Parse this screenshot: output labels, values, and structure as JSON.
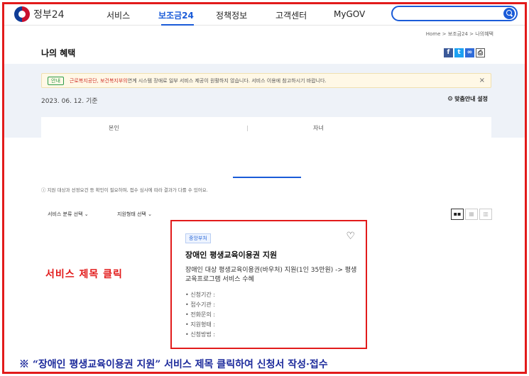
{
  "header": {
    "logo_text": "정부24",
    "nav": [
      "서비스",
      "보조금24",
      "정책정보",
      "고객센터",
      "MyGOV"
    ],
    "active_nav": "보조금24",
    "search_placeholder": ""
  },
  "breadcrumb": "Home  >  보조금24  >  나의혜택",
  "page_title": "나의 혜택",
  "share": {
    "facebook": "f",
    "twitter": "t",
    "link": "∞",
    "print": "⎙"
  },
  "notice": {
    "tag": "안내",
    "red_text": "근로복지공단, 보건복지부의",
    "text": " 연계 시스템 장애로 일부 서비스 제공이 원활하지 않습니다. 서비스 이용에 참고하시기 바랍니다.",
    "close": "×"
  },
  "date_line": "2023. 06. 12. 기준",
  "custom_setting": "맞춤안내 설정",
  "tabs": [
    "본인",
    "자녀"
  ],
  "info_line": "ⓘ  지원 대상과 선정요건 등 확인이 필요하며, 접수 심사에 따라 결과가 다를 수 있어요.",
  "filters": [
    "서비스 분류 선택",
    "지원형태 선택"
  ],
  "view_toggle": [
    "▪▪",
    "▦",
    "▥"
  ],
  "card": {
    "badge": "중앙부처",
    "title": "장애인 평생교육이용권 지원",
    "desc": "장애인 대상 평생교육이용권(바우처) 지원(1인 35만원) -> 평생교육프로그램 서비스 수혜",
    "fields": [
      "신청기간 :",
      "접수기관 :",
      "전화문의 :",
      "지원형태 :",
      "신청방법 :"
    ]
  },
  "callout": "서비스 제목 클릭",
  "footer_note": "※ “장애인 평생교육이용권 지원” 서비스 제목 클릭하여 신청서 작성·접수",
  "colors": {
    "accent": "#1a5bd8",
    "highlight": "#e21b1b",
    "note": "#1d2b9c"
  }
}
